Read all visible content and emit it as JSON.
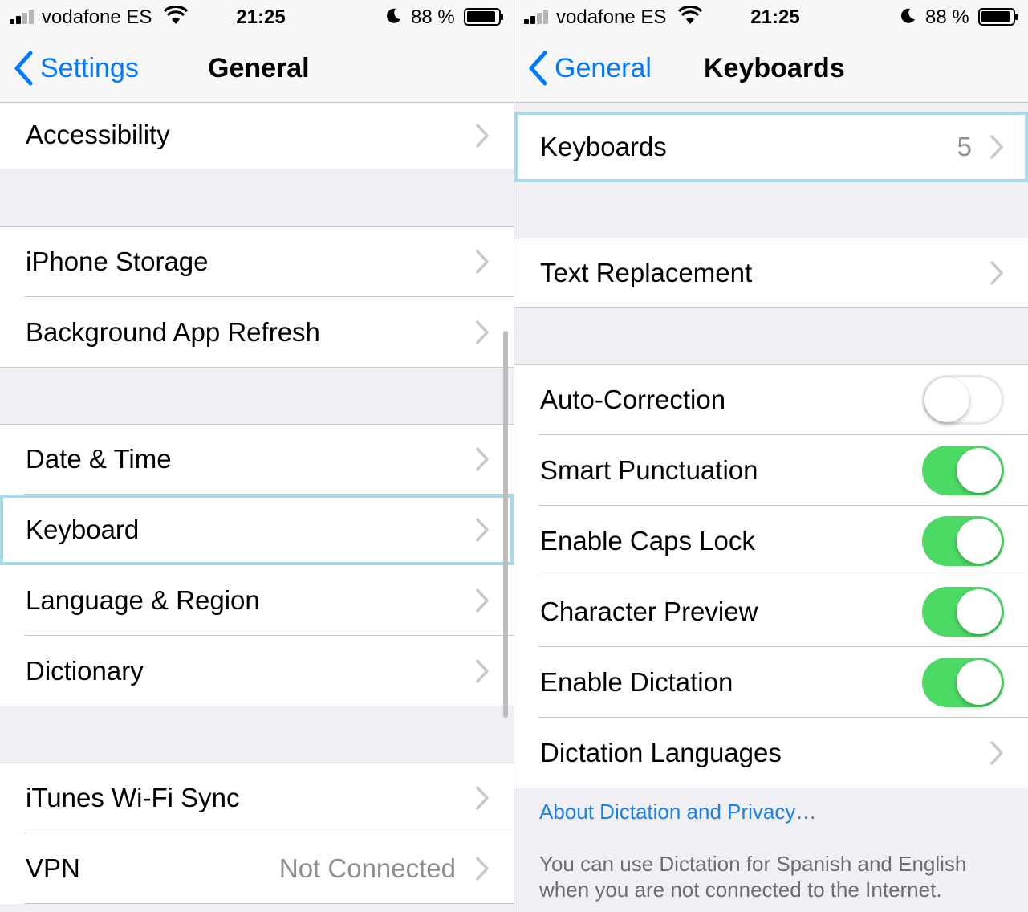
{
  "status_bar": {
    "carrier": "vodafone ES",
    "time": "21:25",
    "battery_percent": "88 %"
  },
  "left": {
    "nav": {
      "back_label": "Settings",
      "title": "General"
    },
    "rows": {
      "accessibility": "Accessibility",
      "iphone_storage": "iPhone Storage",
      "background_refresh": "Background App Refresh",
      "date_time": "Date & Time",
      "keyboard": "Keyboard",
      "language_region": "Language & Region",
      "dictionary": "Dictionary",
      "itunes_sync": "iTunes Wi-Fi Sync",
      "vpn": "VPN",
      "vpn_status": "Not Connected"
    },
    "highlighted_row": "Keyboard"
  },
  "right": {
    "nav": {
      "back_label": "General",
      "title": "Keyboards"
    },
    "keyboards_label": "Keyboards",
    "keyboards_count": "5",
    "text_replacement": "Text Replacement",
    "toggles": [
      {
        "label": "Auto-Correction",
        "on": false
      },
      {
        "label": "Smart Punctuation",
        "on": true
      },
      {
        "label": "Enable Caps Lock",
        "on": true
      },
      {
        "label": "Character Preview",
        "on": true
      },
      {
        "label": "Enable Dictation",
        "on": true
      }
    ],
    "dictation_languages": "Dictation Languages",
    "privacy_link": "About Dictation and Privacy…",
    "footer_note": "You can use Dictation for Spanish and English when you are not connected to the Internet."
  },
  "colors": {
    "ios_blue": "#007aff",
    "toggle_on": "#4cd964",
    "grouped_background": "#efeff4",
    "highlight_outline": "#a6dbe6"
  },
  "icons": [
    "signal-icon",
    "wifi-icon",
    "moon-icon",
    "battery-icon",
    "back-chevron-icon",
    "chevron-right-icon"
  ]
}
